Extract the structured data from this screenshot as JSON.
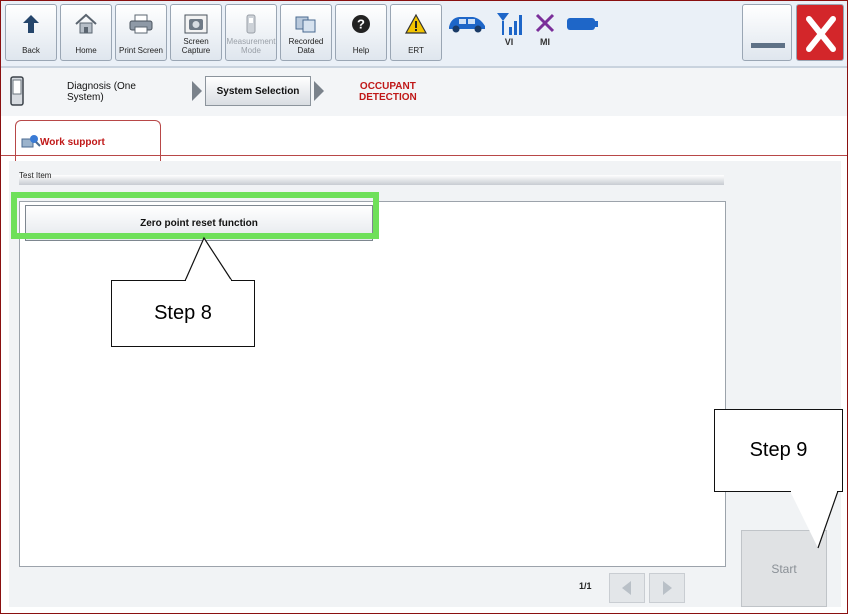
{
  "toolbar": {
    "buttons": [
      {
        "label": "Back",
        "icon": "back-arrow-icon"
      },
      {
        "label": "Home",
        "icon": "home-icon"
      },
      {
        "label": "Print Screen",
        "icon": "printer-icon"
      },
      {
        "label": "Screen\nCapture",
        "icon": "camera-icon"
      },
      {
        "label": "Measurement\nMode",
        "icon": "measurement-icon",
        "disabled": true
      },
      {
        "label": "Recorded\nData",
        "icon": "recorded-data-icon"
      },
      {
        "label": "Help",
        "icon": "help-icon"
      },
      {
        "label": "ERT",
        "icon": "warning-icon"
      }
    ],
    "status": {
      "vi_label": "VI",
      "mi_label": "MI"
    }
  },
  "breadcrumb": {
    "diagnosis": "Diagnosis (One\nSystem)",
    "system_selection": "System Selection",
    "current": "OCCUPANT\nDETECTION"
  },
  "tab": {
    "label": "Work support"
  },
  "list": {
    "header": "Test Item",
    "items": [
      "Zero point reset function"
    ],
    "page": "1/1"
  },
  "start_button": {
    "label": "Start"
  },
  "callouts": {
    "step8": "Step 8",
    "step9": "Step 9"
  },
  "colors": {
    "highlight": "#6fe05a",
    "close": "#d3262a",
    "accent_red": "#c01818",
    "status_blue": "#1e66c8",
    "mi_purple": "#7b2f9a"
  }
}
